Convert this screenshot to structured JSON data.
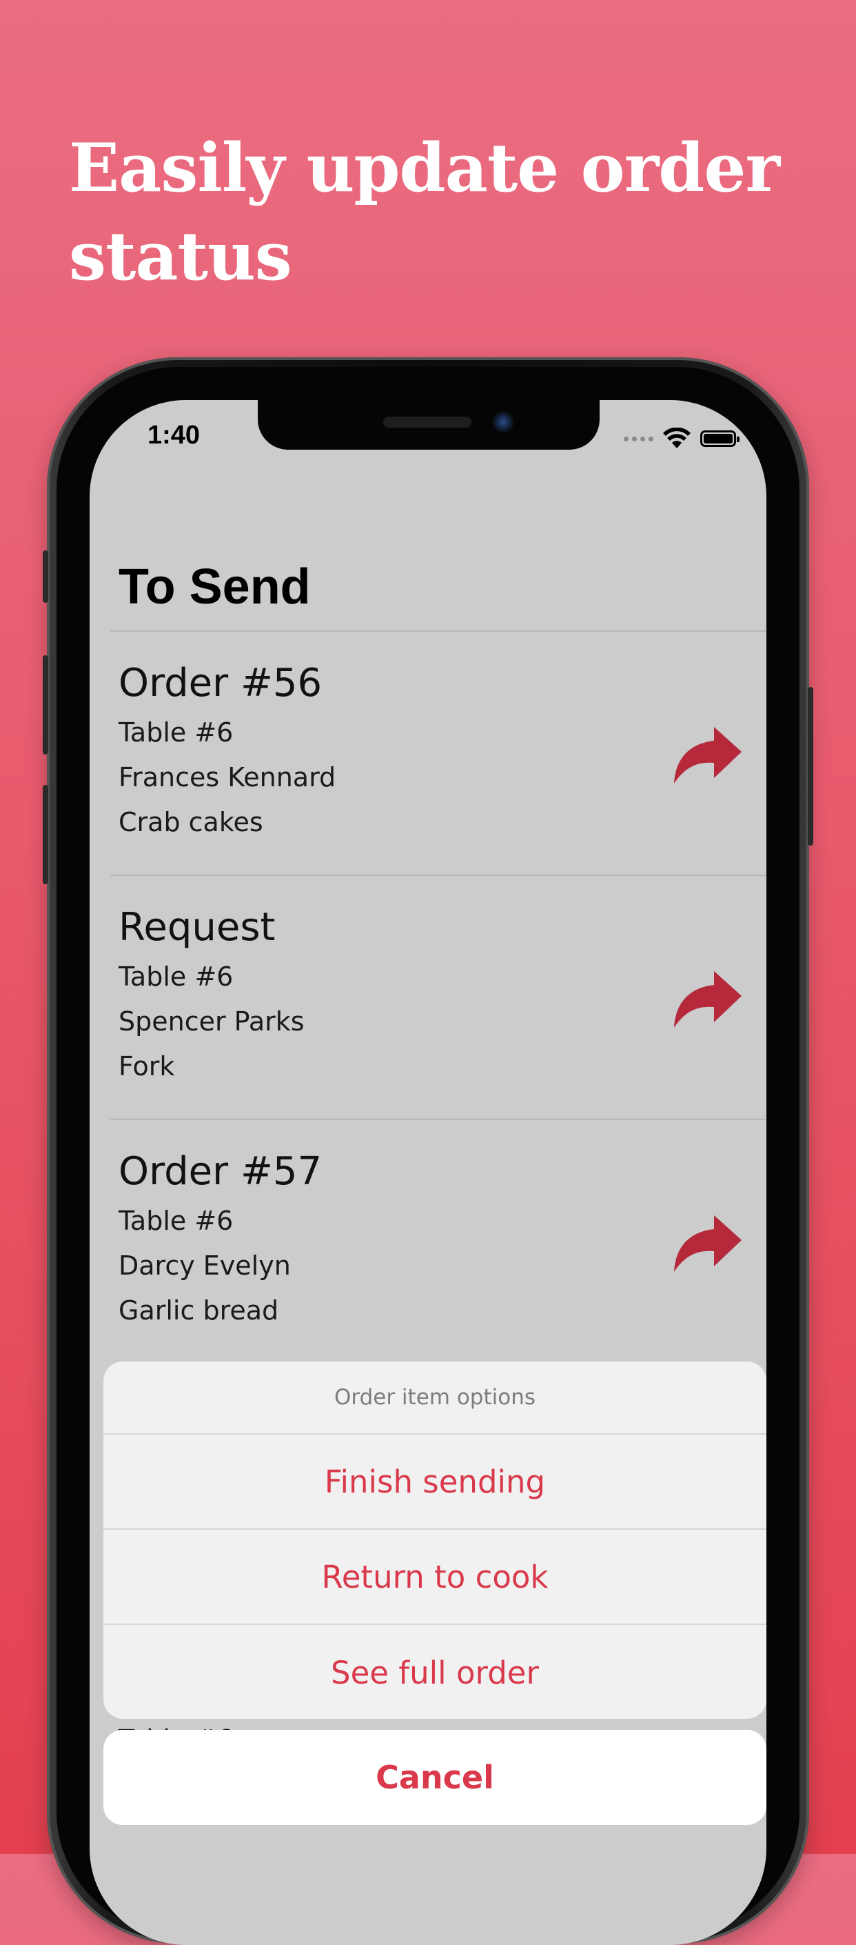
{
  "banner": {
    "headline": "Easily update order status"
  },
  "status_bar": {
    "time": "1:40",
    "icons": [
      "signal-dots-icon",
      "wifi-icon",
      "battery-icon"
    ]
  },
  "screen": {
    "title": "To Send"
  },
  "orders": [
    {
      "title": "Order #56",
      "table": "Table #6",
      "customer": "Frances Kennard",
      "item": "Crab cakes"
    },
    {
      "title": "Request",
      "table": "Table #6",
      "customer": "Spencer Parks",
      "item": "Fork"
    },
    {
      "title": "Order #57",
      "table": "Table #6",
      "customer": "Darcy Evelyn",
      "item": "Garlic bread"
    }
  ],
  "partial_row": {
    "table": "Table #6"
  },
  "action_sheet": {
    "title": "Order item options",
    "actions": [
      "Finish sending",
      "Return to cook",
      "See full order"
    ],
    "cancel": "Cancel"
  },
  "colors": {
    "accent": "#d9394b",
    "send_icon": "#b5293a",
    "background_top": "#ea6d82",
    "background_bottom": "#e3404f",
    "screen_bg": "#cccccc"
  }
}
